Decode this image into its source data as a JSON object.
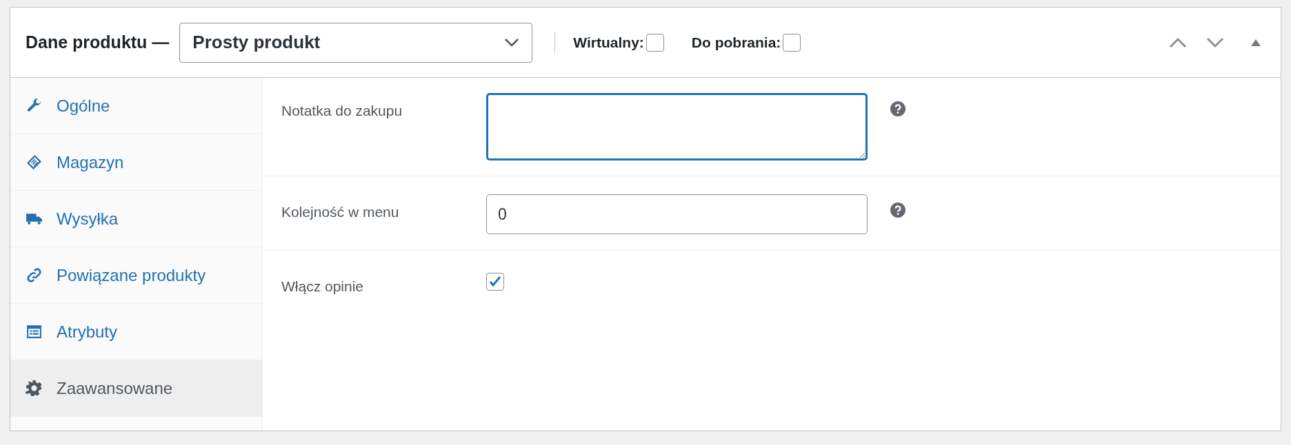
{
  "header": {
    "title": "Dane produktu —",
    "product_type": {
      "value": "Prosty produkt"
    },
    "options": [
      {
        "label": "Wirtualny:",
        "checked": false
      },
      {
        "label": "Do pobrania:",
        "checked": false
      }
    ]
  },
  "tabs": [
    {
      "label": "Ogólne",
      "selected": false
    },
    {
      "label": "Magazyn",
      "selected": false
    },
    {
      "label": "Wysyłka",
      "selected": false
    },
    {
      "label": "Powiązane produkty",
      "selected": false
    },
    {
      "label": "Atrybuty",
      "selected": false
    },
    {
      "label": "Zaawansowane",
      "selected": true
    }
  ],
  "fields": [
    {
      "kind": "textarea",
      "label": "Notatka do zakupu",
      "focused": true,
      "help": true
    },
    {
      "kind": "number",
      "label": "Kolejność w menu",
      "value": "0",
      "focused": false,
      "help": true
    },
    {
      "kind": "checkbox",
      "label": "Włącz opinie",
      "checked": true,
      "help": false
    }
  ]
}
